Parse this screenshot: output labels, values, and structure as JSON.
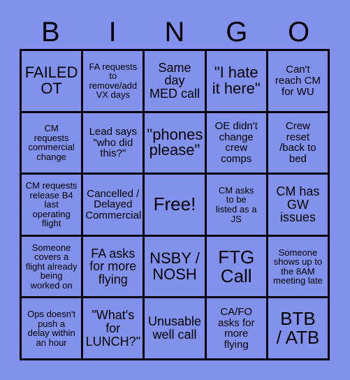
{
  "header": {
    "letters": [
      "B",
      "I",
      "N",
      "G",
      "O"
    ]
  },
  "colors": {
    "background": "#8191ec",
    "cell_background": "#8191ec",
    "border": "#000000",
    "text": "#000000"
  },
  "grid": {
    "rows": 5,
    "columns": 5,
    "cells": [
      {
        "text": "FAILED\nOT",
        "size": "lg"
      },
      {
        "text": "FA requests\nto\nremove/add\nVX days",
        "size": "xs"
      },
      {
        "text": "Same\nday\nMED call",
        "size": "md"
      },
      {
        "text": "\"I hate\nit here\"",
        "size": "lg"
      },
      {
        "text": "Can't\nreach CM\nfor WU",
        "size": "sm"
      },
      {
        "text": "CM\nrequests\ncommercial\nchange",
        "size": "xs"
      },
      {
        "text": "Lead says\n\"who did\nthis?\"",
        "size": "sm"
      },
      {
        "text": "\"phones\nplease\"",
        "size": "lg"
      },
      {
        "text": "OE didn't\nchange\ncrew\ncomps",
        "size": "sm"
      },
      {
        "text": "Crew\nreset\n/back to\nbed",
        "size": "sm"
      },
      {
        "text": "CM requests\nrelease B4\nlast\noperating\nflight",
        "size": "xs"
      },
      {
        "text": "Cancelled /\nDelayed\nCommercial",
        "size": "sm"
      },
      {
        "text": "Free!",
        "size": "xl"
      },
      {
        "text": "CM asks\nto be\nlisted as a\nJS",
        "size": "xs"
      },
      {
        "text": "CM has\nGW\nissues",
        "size": "md"
      },
      {
        "text": "Someone\ncovers a\nflight already\nbeing\nworked on",
        "size": "xs"
      },
      {
        "text": "FA asks\nfor more\nflying",
        "size": "md"
      },
      {
        "text": "NSBY /\nNOSH",
        "size": "lg"
      },
      {
        "text": "FTG\nCall",
        "size": "xl"
      },
      {
        "text": "Someone\nshows up to\nthe 8AM\nmeeting late",
        "size": "xs"
      },
      {
        "text": "Ops doesn't\npush a\ndelay within\nan hour",
        "size": "xs"
      },
      {
        "text": "\"What's\nfor\nLUNCH?\"",
        "size": "md"
      },
      {
        "text": "Unusable\nwell call",
        "size": "md"
      },
      {
        "text": "CA/FO\nasks for\nmore\nflying",
        "size": "sm"
      },
      {
        "text": "BTB\n/ ATB",
        "size": "xl"
      }
    ]
  }
}
